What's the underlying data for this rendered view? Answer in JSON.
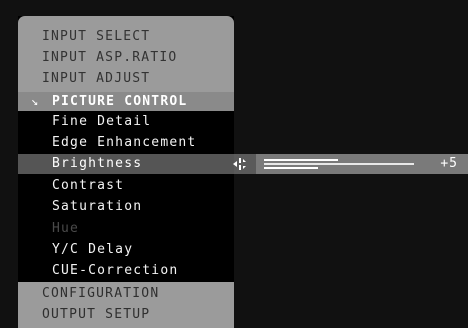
{
  "menu": {
    "top_items": [
      {
        "label": "INPUT SELECT"
      },
      {
        "label": "INPUT ASP.RATIO"
      },
      {
        "label": "INPUT ADJUST"
      }
    ],
    "active_section": {
      "label": "PICTURE CONTROL",
      "arrow_icon": "chevron-down-icon"
    },
    "sub_items": [
      {
        "label": "Fine Detail",
        "enabled": true
      },
      {
        "label": "Edge Enhancement",
        "enabled": true
      },
      {
        "label": "Brightness",
        "enabled": true,
        "selected": true
      },
      {
        "label": "Contrast",
        "enabled": true
      },
      {
        "label": "Saturation",
        "enabled": true
      },
      {
        "label": "Hue",
        "enabled": false
      },
      {
        "label": "Y/C Delay",
        "enabled": true
      },
      {
        "label": "CUE-Correction",
        "enabled": true
      }
    ],
    "bottom_items": [
      {
        "label": "CONFIGURATION"
      },
      {
        "label": "OUTPUT SETUP"
      }
    ]
  },
  "brightness_slider": {
    "value_text": "+5",
    "value": 5,
    "adjust_icon": "left-right-arrows-icon"
  },
  "colors": {
    "menu_panel": "#9b9b9b",
    "selected_row": "#7a7a7a",
    "text_primary": "#ffffff",
    "text_disabled": "#4a4a4a",
    "background": "#111111"
  }
}
